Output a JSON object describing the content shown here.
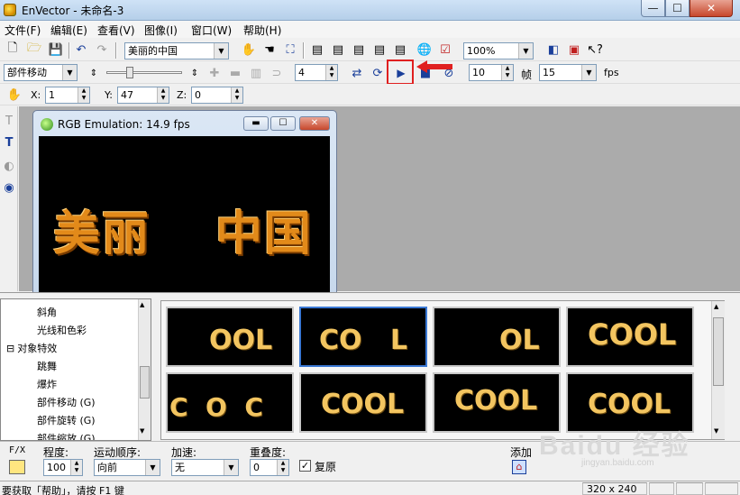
{
  "window": {
    "title": "EnVector - 未命名-3",
    "min": "—",
    "max": "☐",
    "close": "✕"
  },
  "menu": [
    "文件(F)",
    "编辑(E)",
    "查看(V)",
    "图像(I)",
    "窗口(W)",
    "帮助(H)"
  ],
  "toolbar1": {
    "text_combo": "美丽的中国",
    "zoom_combo": "100%"
  },
  "toolbar2": {
    "effect_combo": "部件移动",
    "frame_spin": "4",
    "frames_spin": "10",
    "frame_label": "帧",
    "fps_value": "15",
    "fps_label": "fps"
  },
  "toolbar3": {
    "x_label": "X:",
    "x_value": "1",
    "y_label": "Y:",
    "y_value": "47",
    "z_label": "Z:",
    "z_value": "0"
  },
  "child_window": {
    "title": "RGB Emulation: 14.9 fps",
    "text_left": "美丽",
    "text_right": "中国"
  },
  "tree": [
    {
      "label": "斜角",
      "indent": 2
    },
    {
      "label": "光线和色彩",
      "indent": 2
    },
    {
      "label": "对象特效",
      "indent": 1,
      "expander": "⊟"
    },
    {
      "label": "跳舞",
      "indent": 2
    },
    {
      "label": "爆炸",
      "indent": 2
    },
    {
      "label": "部件移动 (G)",
      "indent": 2
    },
    {
      "label": "部件旋转 (G)",
      "indent": 2
    },
    {
      "label": "部件缩放 (G)",
      "indent": 2
    }
  ],
  "thumbnails": [
    {
      "text": "OOL",
      "selected": false
    },
    {
      "text": "CO   L",
      "selected": true
    },
    {
      "text": "OL",
      "selected": false
    },
    {
      "text": "COOL",
      "selected": false
    },
    {
      "text": "C  O  C",
      "selected": false
    },
    {
      "text": "COOL",
      "selected": false
    },
    {
      "text": "COOL",
      "selected": false
    },
    {
      "text": "COOL",
      "selected": false
    }
  ],
  "props": {
    "fx_label": "F/X",
    "degree_label": "程度:",
    "degree_value": "100",
    "order_label": "运动顺序:",
    "order_value": "向前",
    "accel_label": "加速:",
    "accel_value": "无",
    "overlap_label": "重叠度:",
    "overlap_value": "0",
    "restore_label": "复原",
    "restore_checked": true,
    "add_label": "添加"
  },
  "status": {
    "help_text": "要获取「帮助」，请按 F1 键",
    "size_text": "320 x 240"
  },
  "watermark": {
    "brand": "Baidu 经验",
    "url": "jingyan.baidu.com"
  }
}
